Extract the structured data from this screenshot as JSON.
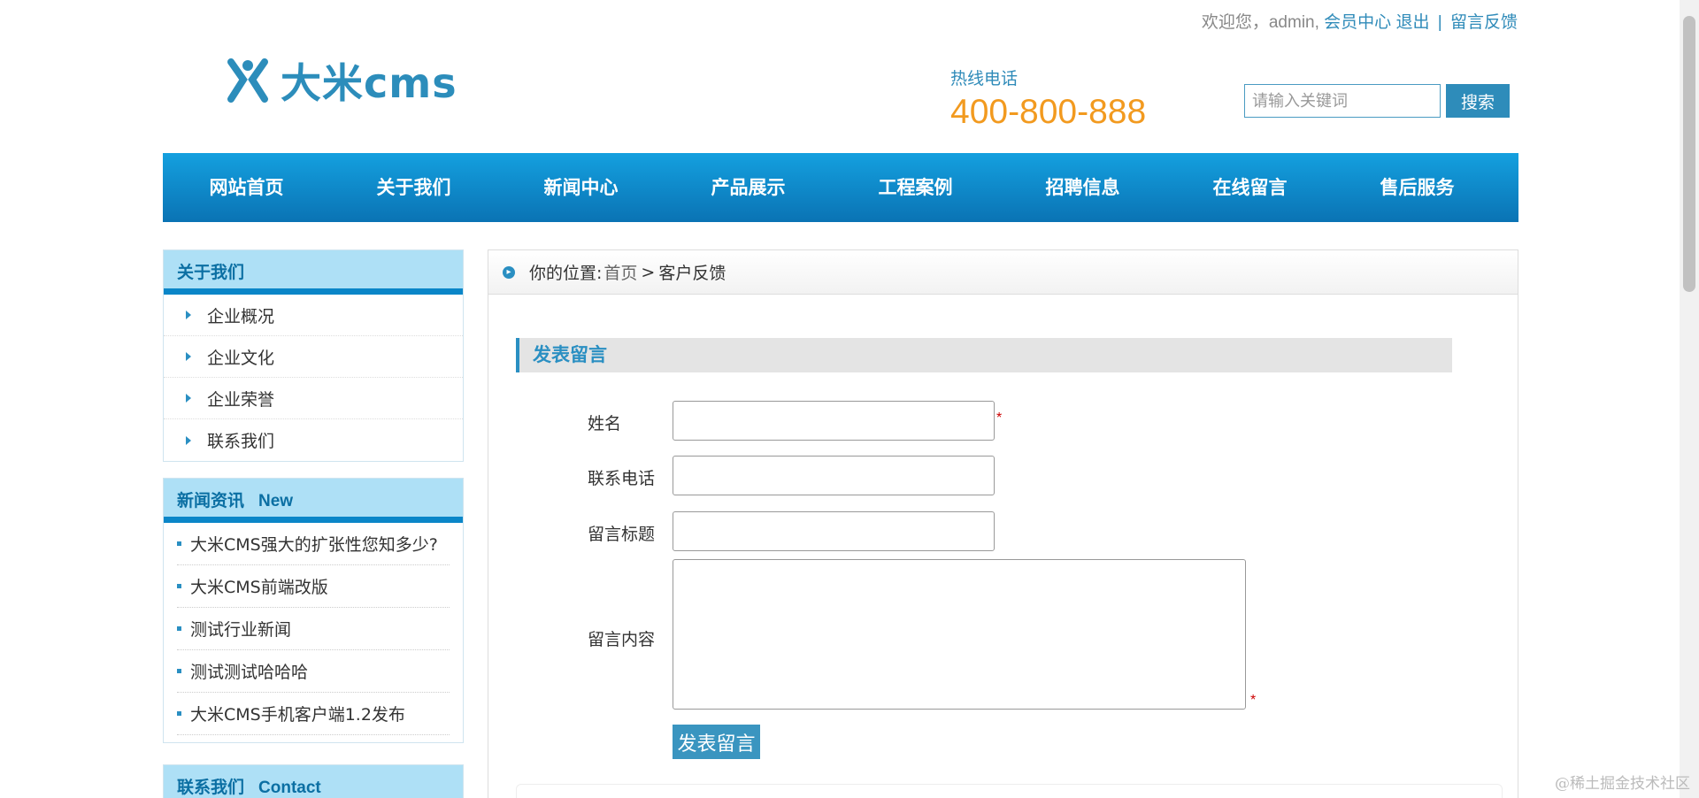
{
  "topbar": {
    "welcome": "欢迎您，admin,",
    "member_center": "会员中心",
    "logout": "退出",
    "separator": "|",
    "guestbook": "留言反馈"
  },
  "logo": {
    "text": "大米cms"
  },
  "hotline": {
    "label": "热线电话",
    "number": "400-800-888"
  },
  "search": {
    "placeholder": "请输入关键词",
    "button": "搜索"
  },
  "nav": [
    "网站首页",
    "关于我们",
    "新闻中心",
    "产品展示",
    "工程案例",
    "招聘信息",
    "在线留言",
    "售后服务"
  ],
  "sidebar": {
    "about": {
      "title": "关于我们",
      "items": [
        "企业概况",
        "企业文化",
        "企业荣誉",
        "联系我们"
      ]
    },
    "news": {
      "title": "新闻资讯",
      "title_en": "New",
      "items": [
        "大米CMS强大的扩张性您知多少?",
        "大米CMS前端改版",
        "测试行业新闻",
        "测试测试哈哈哈",
        "大米CMS手机客户端1.2发布"
      ]
    },
    "contact": {
      "title": "联系我们",
      "title_en": "Contact"
    }
  },
  "breadcrumb": {
    "prefix": "你的位置:",
    "home": "首页",
    "arrow": ">",
    "current": "客户反馈"
  },
  "form": {
    "title": "发表留言",
    "name_label": "姓名",
    "phone_label": "联系电话",
    "subject_label": "留言标题",
    "content_label": "留言内容",
    "required_mark": "*",
    "submit": "发表留言"
  },
  "watermark": "@稀土掘金技术社区",
  "colors": {
    "accent": "#2a8fc2",
    "nav_top": "#14a0df",
    "nav_bottom": "#0a73b4",
    "hotline": "#f29a1f",
    "required": "#cc0000"
  }
}
